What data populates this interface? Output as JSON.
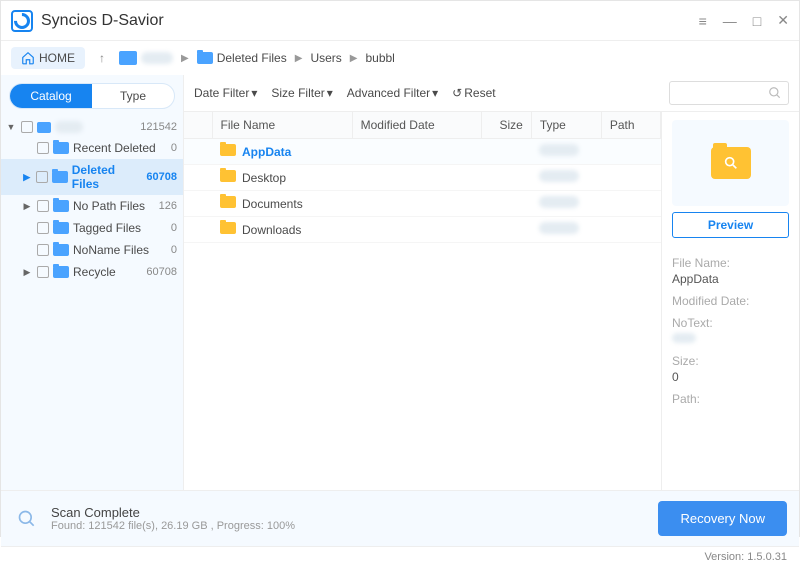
{
  "app": {
    "title": "Syncios D-Savior"
  },
  "nav": {
    "home": "HOME",
    "crumbs": [
      "",
      "Deleted Files",
      "Users",
      "bubbl"
    ]
  },
  "sidebar": {
    "tabs": {
      "catalog": "Catalog",
      "type": "Type"
    },
    "root": {
      "label": "",
      "count": "121542"
    },
    "items": [
      {
        "label": "Recent Deleted",
        "count": "0"
      },
      {
        "label": "Deleted Files",
        "count": "60708"
      },
      {
        "label": "No Path Files",
        "count": "126"
      },
      {
        "label": "Tagged Files",
        "count": "0"
      },
      {
        "label": "NoName Files",
        "count": "0"
      },
      {
        "label": "Recycle",
        "count": "60708"
      }
    ]
  },
  "filters": {
    "date": "Date Filter",
    "size": "Size Filter",
    "adv": "Advanced Filter",
    "reset": "Reset"
  },
  "columns": {
    "name": "File Name",
    "modified": "Modified Date",
    "size": "Size",
    "type": "Type",
    "path": "Path"
  },
  "rows": [
    {
      "name": "AppData"
    },
    {
      "name": "Desktop"
    },
    {
      "name": "Documents"
    },
    {
      "name": "Downloads"
    }
  ],
  "preview": {
    "button": "Preview",
    "labels": {
      "fname": "File Name:",
      "mdate": "Modified Date:",
      "notext": "NoText:",
      "size": "Size:",
      "path": "Path:"
    },
    "values": {
      "fname": "AppData",
      "size": "0"
    }
  },
  "status": {
    "title": "Scan Complete",
    "detail": "Found: 121542 file(s), 26.19 GB , Progress: 100%",
    "recover": "Recovery Now"
  },
  "version": "Version: 1.5.0.31"
}
